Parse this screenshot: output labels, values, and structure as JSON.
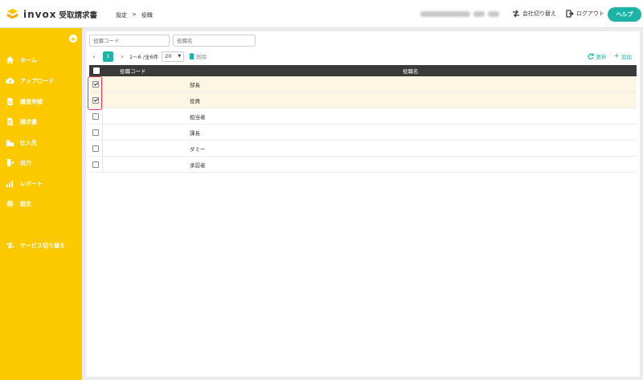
{
  "app": {
    "brand": "invox",
    "product": "受取請求書",
    "brand_color": "#fcc800",
    "accent_color": "#1eb3a6"
  },
  "breadcrumb": [
    "設定",
    ">",
    "役職"
  ],
  "header": {
    "switch_company": "会社切り替え",
    "logout": "ログアウト",
    "help": "ヘルプ"
  },
  "sidebar": {
    "items": [
      {
        "label": "ホーム",
        "icon": "home-icon"
      },
      {
        "label": "アップロード",
        "icon": "cloud-upload-icon"
      },
      {
        "label": "購買申請",
        "icon": "document-icon"
      },
      {
        "label": "請求書",
        "icon": "invoice-icon"
      },
      {
        "label": "仕入先",
        "icon": "building-icon"
      },
      {
        "label": "出力",
        "icon": "export-icon"
      },
      {
        "label": "レポート",
        "icon": "chart-icon"
      },
      {
        "label": "設定",
        "icon": "gear-icon"
      },
      {
        "label": "サービス切り替え",
        "icon": "switch-icon"
      }
    ]
  },
  "filters": {
    "code_placeholder": "役職コード",
    "name_placeholder": "役職名"
  },
  "pager": {
    "current_page": "1",
    "range": "1〜6 /全6件",
    "page_size": "20",
    "delete": "削除"
  },
  "actions": {
    "refresh": "更新",
    "add": "追加"
  },
  "table": {
    "columns": [
      "役職コード",
      "役職名"
    ],
    "rows": [
      {
        "code": "",
        "name": "部長",
        "checked": true
      },
      {
        "code": "",
        "name": "役員",
        "checked": true
      },
      {
        "code": "",
        "name": "担当者",
        "checked": false
      },
      {
        "code": "",
        "name": "課長",
        "checked": false
      },
      {
        "code": "",
        "name": "ダミー",
        "checked": false
      },
      {
        "code": "",
        "name": "承認者",
        "checked": false
      }
    ]
  }
}
